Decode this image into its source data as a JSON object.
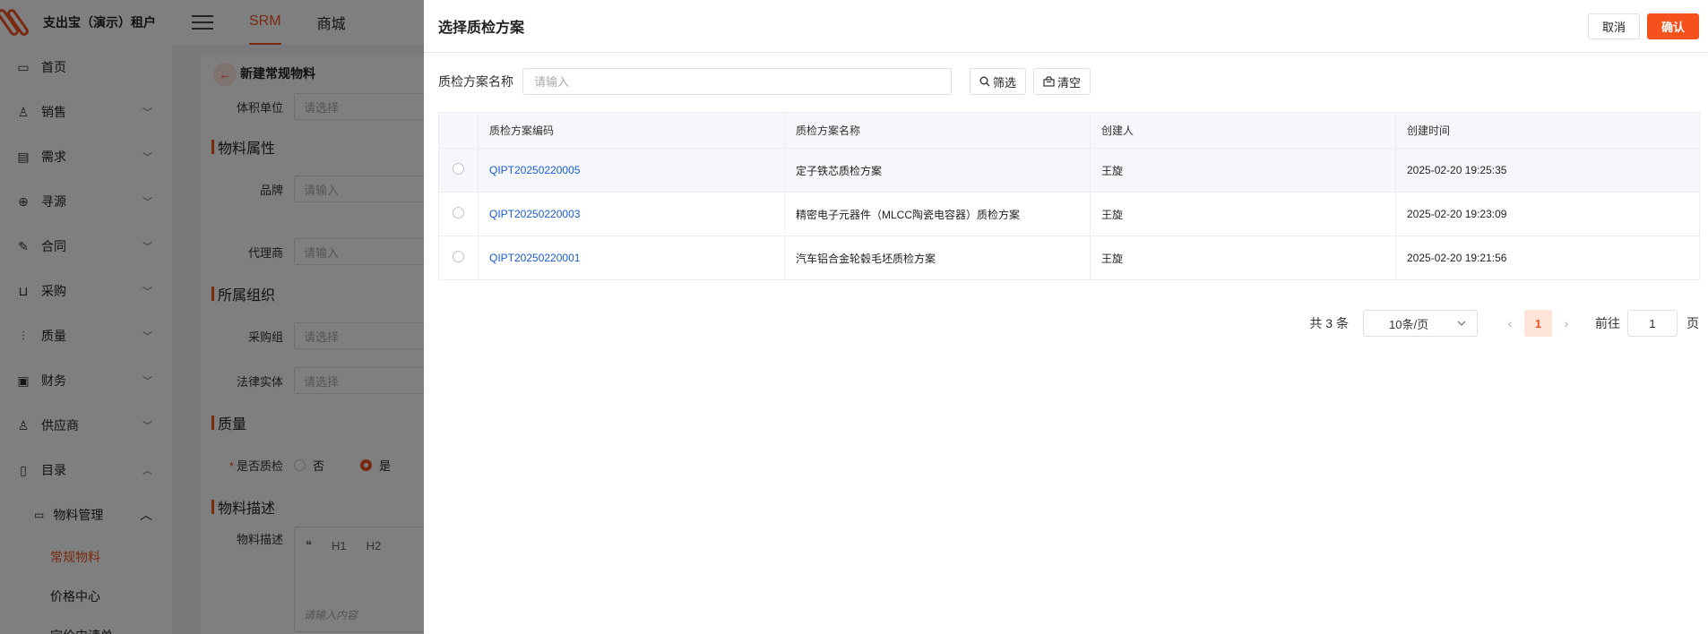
{
  "app": {
    "tenant": "支出宝（演示）租户",
    "top_nav": [
      "SRM",
      "商城"
    ],
    "sidebar": {
      "items": [
        {
          "label": "首页",
          "icon": "monitor-icon"
        },
        {
          "label": "销售",
          "icon": "user-icon"
        },
        {
          "label": "需求",
          "icon": "clipboard-icon"
        },
        {
          "label": "寻源",
          "icon": "search-icon"
        },
        {
          "label": "合同",
          "icon": "pen-icon"
        },
        {
          "label": "采购",
          "icon": "cart-icon"
        },
        {
          "label": "质量",
          "icon": "sliders-icon"
        },
        {
          "label": "财务",
          "icon": "wallet-icon"
        },
        {
          "label": "供应商",
          "icon": "user-icon"
        },
        {
          "label": "目录",
          "icon": "book-icon"
        }
      ],
      "sub_group": "物料管理",
      "leaves": [
        "常规物料",
        "价格中心",
        "定价申请单"
      ]
    },
    "page": {
      "title": "新建常规物料",
      "volume_unit_label": "体积单位",
      "select_placeholder": "请选择",
      "input_placeholder": "请输入",
      "sections": {
        "attributes": "物料属性",
        "org": "所属组织",
        "quality": "质量",
        "description": "物料描述"
      },
      "brand_label": "品牌",
      "agent_label": "代理商",
      "purchase_group_label": "采购组",
      "legal_entity_label": "法律实体",
      "quality_check_label": "是否质检",
      "quality_no": "否",
      "quality_yes": "是",
      "desc_label": "物料描述",
      "editor_tools": [
        "❝",
        "H1",
        "H2"
      ],
      "editor_placeholder": "请输入内容"
    }
  },
  "drawer": {
    "title": "选择质检方案",
    "cancel": "取消",
    "confirm": "确认",
    "filter": {
      "label": "质检方案名称",
      "placeholder": "请输入",
      "value": "",
      "filter_btn": "筛选",
      "clear_btn": "清空"
    },
    "columns": [
      "质检方案编码",
      "质检方案名称",
      "创建人",
      "创建时间"
    ],
    "rows": [
      {
        "code": "QIPT20250220005",
        "name": "定子铁芯质检方案",
        "creator": "王旋",
        "created": "2025-02-20 19:25:35"
      },
      {
        "code": "QIPT20250220003",
        "name": "精密电子元器件（MLCC陶瓷电容器）质检方案",
        "creator": "王旋",
        "created": "2025-02-20 19:23:09"
      },
      {
        "code": "QIPT20250220001",
        "name": "汽车铝合金轮毂毛坯质检方案",
        "creator": "王旋",
        "created": "2025-02-20 19:21:56"
      }
    ],
    "pagination": {
      "total_text": "共 3 条",
      "page_size": "10条/页",
      "current_page": "1",
      "goto_label": "前往",
      "goto_value": "1",
      "page_suffix": "页"
    }
  }
}
